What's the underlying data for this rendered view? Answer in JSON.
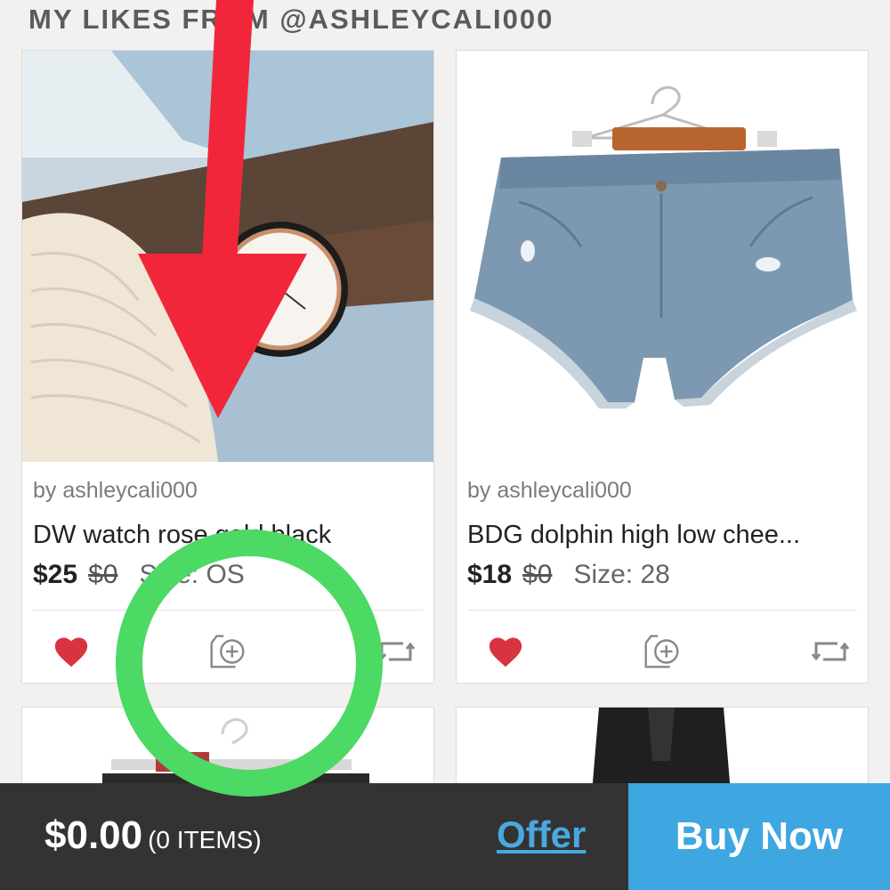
{
  "section": {
    "title": "MY LIKES FROM @ASHLEYCALI000"
  },
  "listings": [
    {
      "seller": "by ashleycali000",
      "title": "DW watch rose gold black",
      "price": "$25",
      "original_price": "$0",
      "size": "Size: OS",
      "liked": true
    },
    {
      "seller": "by ashleycali000",
      "title": "BDG dolphin high low chee...",
      "price": "$18",
      "original_price": "$0",
      "size": "Size: 28",
      "liked": true
    }
  ],
  "bottom_bar": {
    "total_amount": "$0.00",
    "item_count": "(0 ITEMS)",
    "offer_label": "Offer",
    "buy_label": "Buy Now"
  },
  "colors": {
    "heart": "#d9333f",
    "accent": "#3ea6e0",
    "annotation_arrow": "#f2263b",
    "annotation_circle": "#4cd964"
  },
  "icons": [
    "heart-icon",
    "add-to-bundle-icon",
    "share-icon"
  ]
}
